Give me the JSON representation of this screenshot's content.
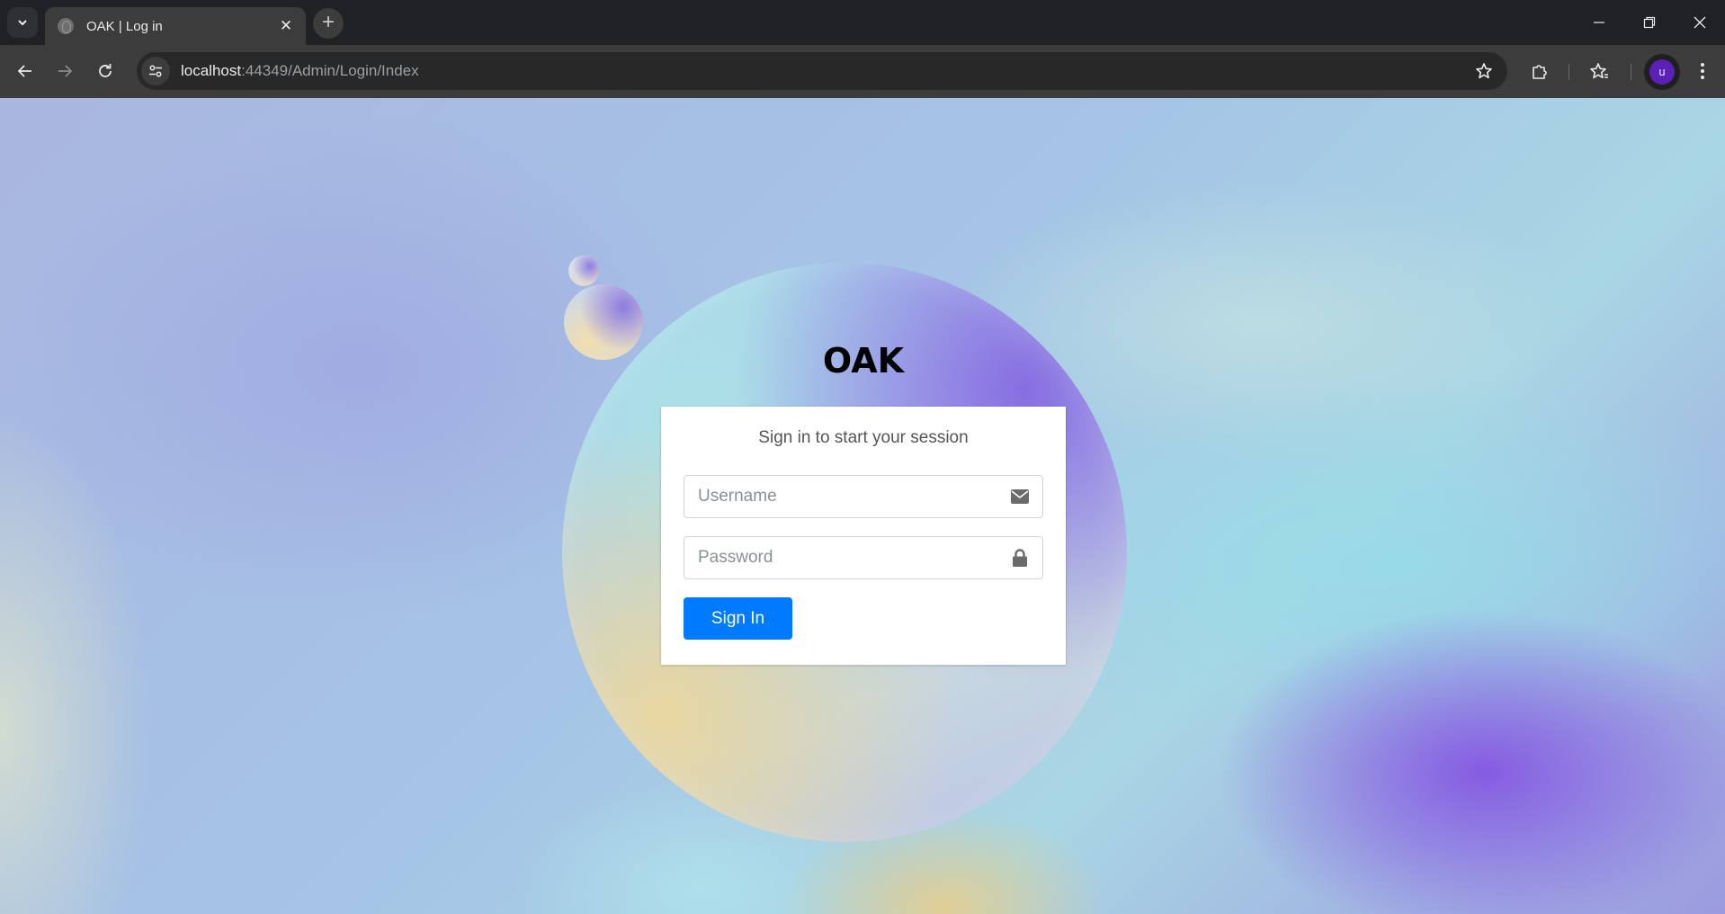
{
  "browser": {
    "tab_title": "OAK | Log in",
    "url_host": "localhost",
    "url_path": ":44349/Admin/Login/Index",
    "avatar_letter": "u",
    "avatar_color": "#5b21b6"
  },
  "page": {
    "brand": "OAK",
    "login_message": "Sign in to start your session",
    "username_placeholder": "Username",
    "password_placeholder": "Password",
    "signin_label": "Sign In",
    "accent_color": "#007bff",
    "icons": [
      "envelope-icon",
      "lock-icon"
    ]
  }
}
